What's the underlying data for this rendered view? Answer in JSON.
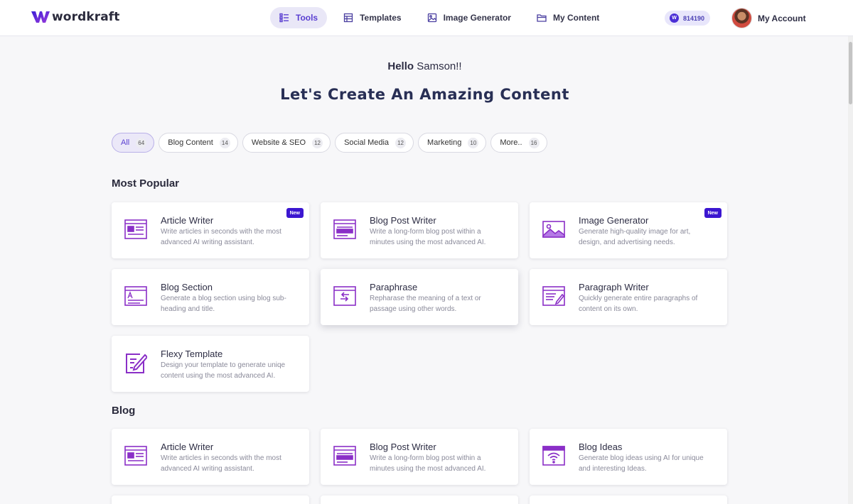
{
  "app": {
    "logo_text": "wordkraft"
  },
  "nav": [
    {
      "label": "Tools",
      "icon": "list-icon",
      "active": true
    },
    {
      "label": "Templates",
      "icon": "table-icon",
      "active": false
    },
    {
      "label": "Image Generator",
      "icon": "image-icon",
      "active": false
    },
    {
      "label": "My Content",
      "icon": "folder-icon",
      "active": false
    }
  ],
  "credits": {
    "badge": "W",
    "value": "814190"
  },
  "account": {
    "label": "My Account"
  },
  "hero": {
    "hello": "Hello",
    "name": "Samson!!",
    "headline": "Let's Create An Amazing Content"
  },
  "filters": [
    {
      "label": "All",
      "count": "64",
      "active": true
    },
    {
      "label": "Blog Content",
      "count": "14"
    },
    {
      "label": "Website & SEO",
      "count": "12"
    },
    {
      "label": "Social Media",
      "count": "12"
    },
    {
      "label": "Marketing",
      "count": "10"
    },
    {
      "label": "More..",
      "count": "16"
    }
  ],
  "sections": {
    "popular": {
      "title": "Most Popular",
      "cards": [
        {
          "title": "Article Writer",
          "desc": "Write articles in seconds with the most advanced AI writing assistant.",
          "badge": "New",
          "icon": "article-icon"
        },
        {
          "title": "Blog Post Writer",
          "desc": "Write a long-form blog post within a minutes using the most advanced AI.",
          "icon": "blog-post-icon"
        },
        {
          "title": "Image Generator",
          "desc": "Generate high-quality image for art, design, and advertising needs.",
          "badge": "New",
          "icon": "image-icon"
        },
        {
          "title": "Blog Section",
          "desc": "Generate a blog section using blog sub-heading and title.",
          "icon": "blog-section-icon"
        },
        {
          "title": "Paraphrase",
          "desc": "Repharase the meaning of a text or passage using other words.",
          "icon": "paraphrase-icon"
        },
        {
          "title": "Paragraph Writer",
          "desc": "Quickly generate entire paragraphs of content on its own.",
          "icon": "paragraph-icon"
        },
        {
          "title": "Flexy Template",
          "desc": "Design your template to generate uniqe content using the most advanced AI.",
          "icon": "edit-icon"
        }
      ]
    },
    "blog": {
      "title": "Blog",
      "cards": [
        {
          "title": "Article Writer",
          "desc": "Write articles in seconds with the most advanced AI writing assistant.",
          "icon": "article-icon"
        },
        {
          "title": "Blog Post Writer",
          "desc": "Write a long-form blog post within a minutes using the most advanced AI.",
          "icon": "blog-post-icon"
        },
        {
          "title": "Blog Ideas",
          "desc": "Generate blog ideas using AI for unique and interesting Ideas.",
          "icon": "wifi-icon"
        }
      ]
    }
  },
  "colors": {
    "accent": "#5a3fd1",
    "icon": "#8a2fc7",
    "badge": "#3b16d0"
  }
}
